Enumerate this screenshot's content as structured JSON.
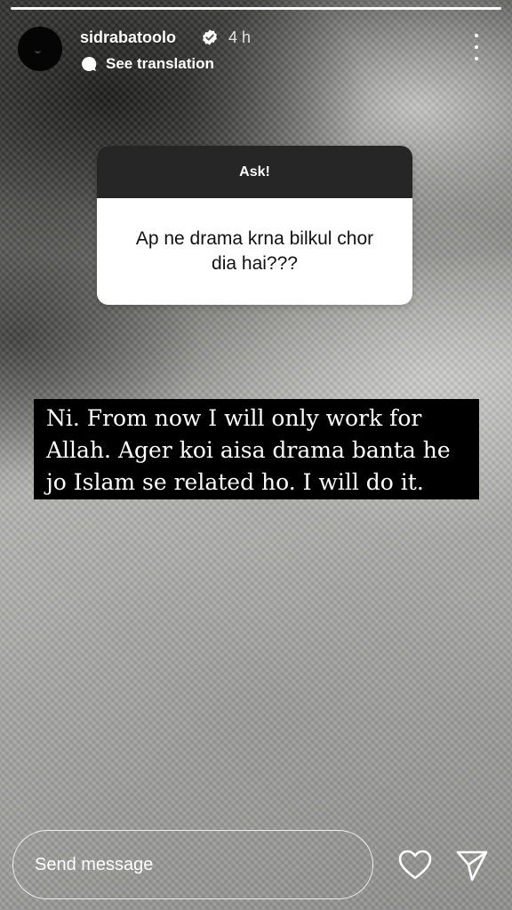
{
  "story": {
    "progress": 1.0,
    "username": "sidrabatoolo",
    "time_ago": "4 h",
    "see_translation": "See translation"
  },
  "question": {
    "header": "Ask!",
    "text": "Ap ne drama krna bilkul chor dia hai???"
  },
  "answer": {
    "lines": [
      "Ni. From now I will only work for",
      "Allah. Ager koi aisa drama banta he",
      "jo Islam se related ho. I will do it."
    ]
  },
  "reply": {
    "placeholder": "Send message"
  },
  "icons": {
    "verified": "verified-badge-icon",
    "translate": "translation-bubble-icon",
    "more": "more-options-icon",
    "like": "heart-icon",
    "share": "paper-plane-icon"
  },
  "colors": {
    "card_header": "#262626",
    "card_body": "#ffffff",
    "answer_bg": "#000000"
  }
}
